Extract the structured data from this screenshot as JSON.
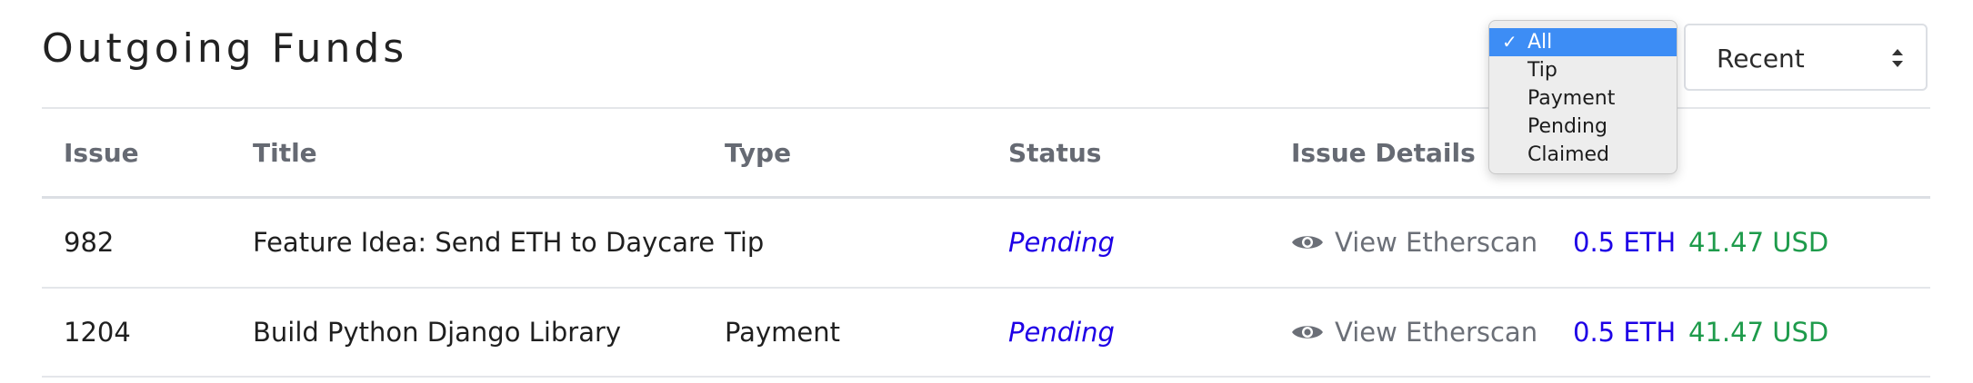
{
  "page": {
    "title": "Outgoing Funds"
  },
  "filter_dropdown": {
    "options": [
      "All",
      "Tip",
      "Payment",
      "Pending",
      "Claimed"
    ],
    "selected": "All",
    "check_glyph": "✓"
  },
  "sort_select": {
    "value": "Recent"
  },
  "table": {
    "headers": {
      "issue": "Issue",
      "title": "Title",
      "type": "Type",
      "status": "Status",
      "details": "Issue Details"
    },
    "rows": [
      {
        "issue": "982",
        "title": "Feature Idea: Send ETH to Daycare",
        "type": "Tip",
        "status": "Pending",
        "details_link": "View Etherscan",
        "eth": "0.5 ETH",
        "usd": "41.47 USD"
      },
      {
        "issue": "1204",
        "title": "Build Python Django Library",
        "type": "Payment",
        "status": "Pending",
        "details_link": "View Etherscan",
        "eth": "0.5 ETH",
        "usd": "41.47 USD"
      }
    ]
  },
  "colors": {
    "status_pending": "#1e00e6",
    "eth_amount": "#1e00e6",
    "usd_amount": "#1e9b4b",
    "dropdown_selected": "#3d8df5"
  },
  "icons": {
    "view": "eye-icon",
    "select_arrows": "up-down-chevron-icon",
    "selected_option": "checkmark-icon"
  }
}
